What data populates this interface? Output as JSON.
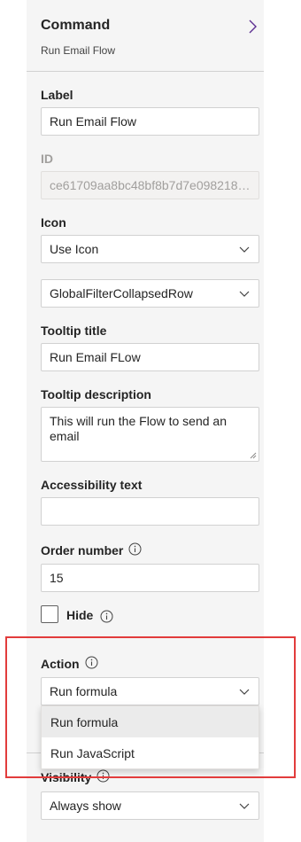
{
  "header": {
    "title": "Command",
    "subtitle": "Run Email Flow"
  },
  "label": {
    "heading": "Label",
    "value": "Run Email Flow"
  },
  "id": {
    "heading": "ID",
    "value": "ce61709aa8bc48bf8b7d7e0982182..."
  },
  "icon": {
    "heading": "Icon",
    "type_value": "Use Icon",
    "icon_value": "GlobalFilterCollapsedRow"
  },
  "tooltip_title": {
    "heading": "Tooltip title",
    "value": "Run Email FLow"
  },
  "tooltip_description": {
    "heading": "Tooltip description",
    "value": "This will run the Flow to send an email"
  },
  "accessibility": {
    "heading": "Accessibility text",
    "value": ""
  },
  "order_number": {
    "heading": "Order number",
    "value": "15"
  },
  "hide": {
    "label": "Hide",
    "checked": false
  },
  "action": {
    "heading": "Action",
    "value": "Run formula",
    "options": [
      "Run formula",
      "Run JavaScript"
    ],
    "selected_index": 0
  },
  "visibility": {
    "heading": "Visibility",
    "value": "Always show"
  },
  "colors": {
    "panel_bg": "#f5f5f5",
    "highlight": "#e23c3c",
    "border": "#d1d1d1",
    "accent": "#5c2e91"
  },
  "icons": [
    "chevron-right-icon",
    "chevron-down-icon",
    "info-icon",
    "resize-grip-icon"
  ]
}
